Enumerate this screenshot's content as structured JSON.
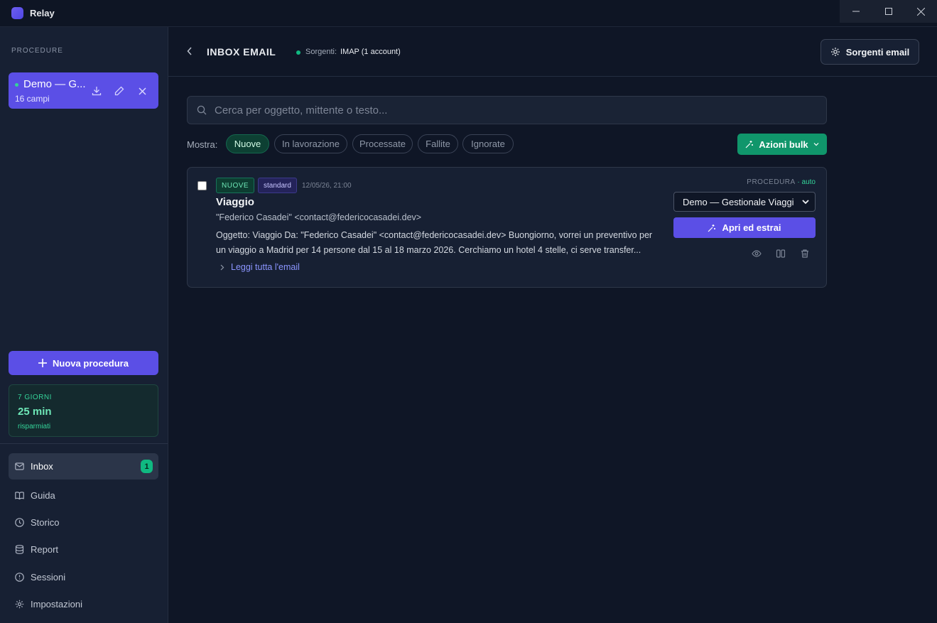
{
  "app": {
    "name": "Relay"
  },
  "sidebar": {
    "section_label": "PROCEDURE",
    "procedure": {
      "name": "Demo — G...",
      "fields": "16 campi"
    },
    "new_procedure_label": "Nuova procedura",
    "stats": {
      "label": "7 GIORNI",
      "value": "25 min",
      "sub": "risparmiati"
    },
    "nav": [
      {
        "label": "Inbox",
        "badge": "1",
        "icon": "mail-icon"
      },
      {
        "label": "Guida",
        "icon": "book-icon"
      },
      {
        "label": "Storico",
        "icon": "clock-icon"
      },
      {
        "label": "Report",
        "icon": "database-icon"
      },
      {
        "label": "Sessioni",
        "icon": "compass-icon"
      },
      {
        "label": "Impostazioni",
        "icon": "gear-icon"
      }
    ]
  },
  "header": {
    "title": "INBOX EMAIL",
    "sources_label": "Sorgenti:",
    "sources_value": "IMAP (1 account)",
    "sources_button": "Sorgenti email"
  },
  "search": {
    "placeholder": "Cerca per oggetto, mittente o testo..."
  },
  "filters": {
    "label": "Mostra:",
    "chips": [
      "Nuove",
      "In lavorazione",
      "Processate",
      "Fallite",
      "Ignorate"
    ],
    "active": "Nuove",
    "bulk_label": "Azioni bulk"
  },
  "email": {
    "status_tag": "NUOVE",
    "type_tag": "standard",
    "date": "12/05/26, 21:00",
    "subject": "Viaggio",
    "from": "\"Federico Casadei\" <contact@federicocasadei.dev>",
    "preview": "Oggetto: Viaggio Da: \"Federico Casadei\" <contact@federicocasadei.dev> Buongiorno, vorrei un preventivo per un viaggio a Madrid per 14 persone dal 15 al 18 marzo 2026. Cerchiamo un hotel 4 stelle, ci serve transfer...",
    "read_more": "Leggi tutta l'email",
    "procedure_label": "PROCEDURA",
    "procedure_mode": "· auto",
    "procedure_selected": "Demo — Gestionale Viaggi",
    "open_button": "Apri ed estrai"
  },
  "colors": {
    "accent": "#5b4fe6",
    "success": "#10966b",
    "background": "#0f1626",
    "sidebar": "#172033"
  }
}
